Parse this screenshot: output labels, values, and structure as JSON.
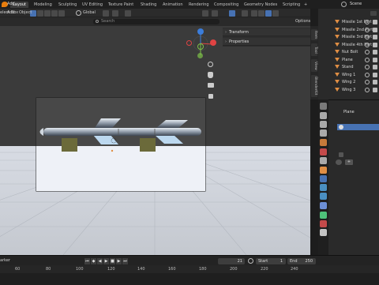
{
  "workspace_tabs": [
    "Layout",
    "Modeling",
    "Sculpting",
    "UV Editing",
    "Texture Paint",
    "Shading",
    "Animation",
    "Rendering",
    "Compositing",
    "Geometry Nodes",
    "Scripting"
  ],
  "workspace_add": "+",
  "scene_label": "Scene",
  "viewport_header": {
    "add_label": "Add",
    "object_label": "Object",
    "transform_orientation": "Global",
    "options_label": "Options",
    "search_placeholder": "Search",
    "select_mode": "elect Box"
  },
  "npanel": {
    "rows": [
      "Transform",
      "Properties"
    ]
  },
  "sidebar_tabs": [
    "Item",
    "Tool",
    "View",
    "BlenderKit"
  ],
  "outliner_items": [
    "Missile 1st Part",
    "Missile 2nd Part",
    "Missile 3rd Part",
    "Missile 4th Part",
    "Nut Bolt",
    "Plane",
    "Stand",
    "Wing 1",
    "Wing 2",
    "Wing 3"
  ],
  "properties": {
    "object_name": "Plane"
  },
  "timeline": {
    "marker_label": "arker",
    "ruler": [
      "60",
      "80",
      "100",
      "120",
      "140",
      "160",
      "180",
      "200",
      "220",
      "240"
    ],
    "current_frame": "21",
    "start_label": "Start",
    "start_value": "1",
    "end_label": "End",
    "end_value": "250"
  },
  "colors": {
    "accent_blue": "#4772b3",
    "gizmo_x": "#e04343",
    "gizmo_y": "#7ec248",
    "gizmo_z": "#3b7ddb",
    "object_orange": "#e08e44"
  }
}
